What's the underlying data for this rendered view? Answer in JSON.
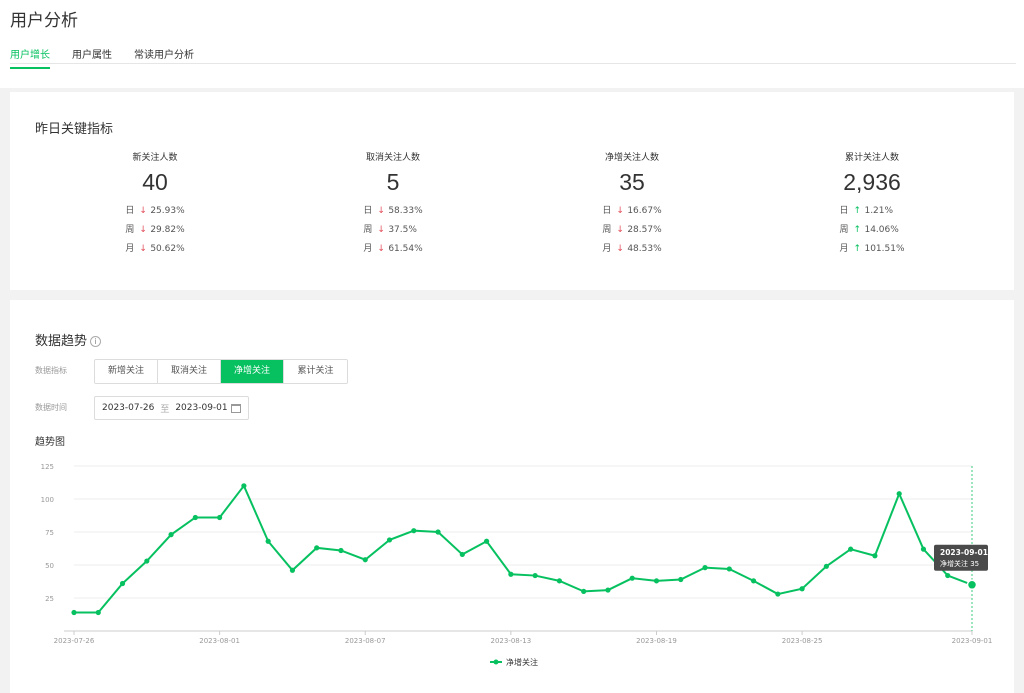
{
  "page_title": "用户分析",
  "tabs": [
    {
      "label": "用户增长",
      "active": true
    },
    {
      "label": "用户属性",
      "active": false
    },
    {
      "label": "常读用户分析",
      "active": false
    }
  ],
  "kpi_section": {
    "title": "昨日关键指标",
    "items": [
      {
        "label": "新关注人数",
        "value": "40",
        "rows": [
          {
            "period": "日",
            "dir": "down",
            "pct": "25.93%"
          },
          {
            "period": "周",
            "dir": "down",
            "pct": "29.82%"
          },
          {
            "period": "月",
            "dir": "down",
            "pct": "50.62%"
          }
        ]
      },
      {
        "label": "取消关注人数",
        "value": "5",
        "rows": [
          {
            "period": "日",
            "dir": "down",
            "pct": "58.33%"
          },
          {
            "period": "周",
            "dir": "down",
            "pct": "37.5%"
          },
          {
            "period": "月",
            "dir": "down",
            "pct": "61.54%"
          }
        ]
      },
      {
        "label": "净增关注人数",
        "value": "35",
        "rows": [
          {
            "period": "日",
            "dir": "down",
            "pct": "16.67%"
          },
          {
            "period": "周",
            "dir": "down",
            "pct": "28.57%"
          },
          {
            "period": "月",
            "dir": "down",
            "pct": "48.53%"
          }
        ]
      },
      {
        "label": "累计关注人数",
        "value": "2,936",
        "rows": [
          {
            "period": "日",
            "dir": "up",
            "pct": "1.21%"
          },
          {
            "period": "周",
            "dir": "up",
            "pct": "14.06%"
          },
          {
            "period": "月",
            "dir": "up",
            "pct": "101.51%"
          }
        ]
      }
    ]
  },
  "trend_section": {
    "title": "数据趋势",
    "help_icon": "i",
    "metric_label": "数据指标",
    "metric_options": [
      {
        "label": "新增关注",
        "active": false
      },
      {
        "label": "取消关注",
        "active": false
      },
      {
        "label": "净增关注",
        "active": true
      },
      {
        "label": "累计关注",
        "active": false
      }
    ],
    "time_label": "数据时间",
    "date_start": "2023-07-26",
    "date_sep": "至",
    "date_end": "2023-09-01",
    "chart_title": "趋势图"
  },
  "chart_data": {
    "type": "line",
    "title": "趋势图",
    "color": "#07c160",
    "ylim": [
      0,
      125
    ],
    "yticks": [
      25,
      50,
      75,
      100,
      125
    ],
    "grid": true,
    "legend": "bottom-center",
    "x": [
      "2023-07-26",
      "2023-07-27",
      "2023-07-28",
      "2023-07-29",
      "2023-07-30",
      "2023-07-31",
      "2023-08-01",
      "2023-08-02",
      "2023-08-03",
      "2023-08-04",
      "2023-08-05",
      "2023-08-06",
      "2023-08-07",
      "2023-08-08",
      "2023-08-09",
      "2023-08-10",
      "2023-08-11",
      "2023-08-12",
      "2023-08-13",
      "2023-08-14",
      "2023-08-15",
      "2023-08-16",
      "2023-08-17",
      "2023-08-18",
      "2023-08-19",
      "2023-08-20",
      "2023-08-21",
      "2023-08-22",
      "2023-08-23",
      "2023-08-24",
      "2023-08-25",
      "2023-08-26",
      "2023-08-27",
      "2023-08-28",
      "2023-08-29",
      "2023-08-30",
      "2023-08-31",
      "2023-09-01"
    ],
    "xticks": [
      "2023-07-26",
      "2023-08-01",
      "2023-08-07",
      "2023-08-13",
      "2023-08-19",
      "2023-08-25",
      "2023-09-01"
    ],
    "series": [
      {
        "name": "净增关注",
        "values": [
          14,
          14,
          36,
          53,
          73,
          86,
          86,
          110,
          68,
          46,
          63,
          61,
          54,
          69,
          76,
          75,
          58,
          68,
          43,
          42,
          38,
          30,
          31,
          40,
          38,
          39,
          48,
          47,
          38,
          28,
          32,
          49,
          62,
          57,
          104,
          62,
          42,
          35
        ]
      }
    ],
    "tooltip": {
      "date": "2023-09-01",
      "series": "净增关注",
      "value": 35
    }
  }
}
